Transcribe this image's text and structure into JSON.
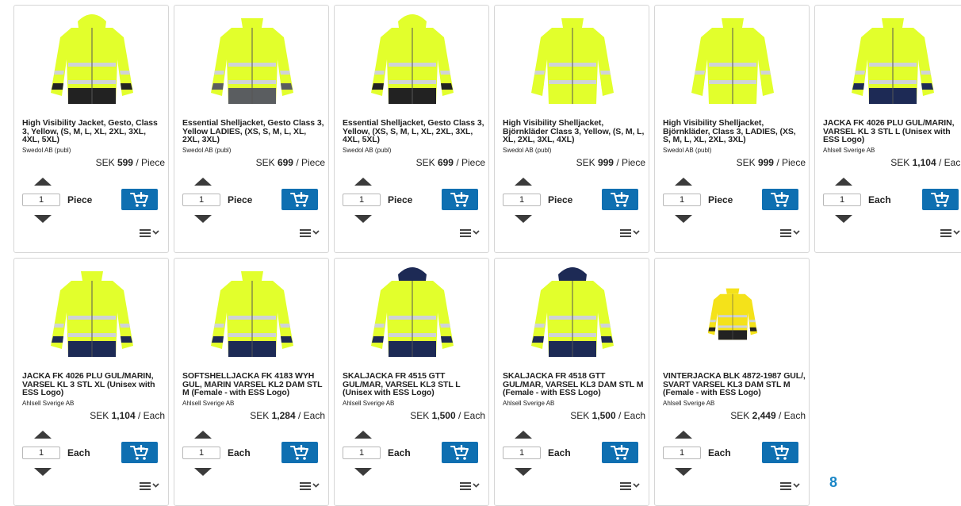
{
  "colors": {
    "accent": "#0e6fb1",
    "page_number": "#1a86c6",
    "jacket_yellow": "#e2ff2c",
    "jacket_navy": "#1d2a55"
  },
  "products": [
    {
      "title": "High Visibility Jacket, Gesto, Class 3, Yellow, (S, M, L, XL, 2XL, 3XL, 4XL, 5XL)",
      "supplier": "Swedol AB (publ)",
      "currency": "SEK",
      "amount": "599",
      "per": "/ Piece",
      "qty": "1",
      "unit": "Piece",
      "image": "hivis-yellow-black-jacket"
    },
    {
      "title": "Essential Shelljacket, Gesto Class 3, Yellow LADIES, (XS, S, M, L, XL, 2XL, 3XL)",
      "supplier": "Swedol AB (publ)",
      "currency": "SEK",
      "amount": "699",
      "per": "/ Piece",
      "qty": "1",
      "unit": "Piece",
      "image": "hivis-yellow-grey-jacket"
    },
    {
      "title": "Essential Shelljacket, Gesto Class 3, Yellow, (XS, S, M, L, XL, 2XL, 3XL, 4XL, 5XL)",
      "supplier": "Swedol AB (publ)",
      "currency": "SEK",
      "amount": "699",
      "per": "/ Piece",
      "qty": "1",
      "unit": "Piece",
      "image": "hivis-yellow-black-jacket"
    },
    {
      "title": "High Visibility Shelljacket, Björnkläder Class 3, Yellow, (S, M, L, XL, 2XL, 3XL, 4XL)",
      "supplier": "Swedol AB (publ)",
      "currency": "SEK",
      "amount": "999",
      "per": "/ Piece",
      "qty": "1",
      "unit": "Piece",
      "image": "hivis-yellow-jacket"
    },
    {
      "title": "High Visibility Shelljacket, Björnkläder, Class 3, LADIES, (XS, S, M, L, XL, 2XL, 3XL)",
      "supplier": "Swedol AB (publ)",
      "currency": "SEK",
      "amount": "999",
      "per": "/ Piece",
      "qty": "1",
      "unit": "Piece",
      "image": "hivis-yellow-jacket"
    },
    {
      "title": "JACKA FK 4026 PLU GUL/MARIN, VARSEL KL 3 STL L (Unisex with ESS Logo)",
      "supplier": "Ahlsell Sverige AB",
      "currency": "SEK",
      "amount": "1,104",
      "per": "/ Each",
      "qty": "1",
      "unit": "Each",
      "image": "hivis-yellow-navy-jacket"
    },
    {
      "title": "JACKA FK 4026 PLU GUL/MARIN, VARSEL KL 3 STL XL (Unisex with ESS Logo)",
      "supplier": "Ahlsell Sverige AB",
      "currency": "SEK",
      "amount": "1,104",
      "per": "/ Each",
      "qty": "1",
      "unit": "Each",
      "image": "hivis-yellow-navy-jacket"
    },
    {
      "title": "SOFTSHELLJACKA FK 4183 WYH GUL, MARIN VARSEL KL2 DAM STL M (Female - with ESS Logo)",
      "supplier": "Ahlsell Sverige AB",
      "currency": "SEK",
      "amount": "1,284",
      "per": "/ Each",
      "qty": "1",
      "unit": "Each",
      "image": "softshell-yellow-navy-jacket"
    },
    {
      "title": "SKALJACKA FR 4515 GTT GUL/MAR, VARSEL KL3 STL L (Unisex with ESS Logo)",
      "supplier": "Ahlsell Sverige AB",
      "currency": "SEK",
      "amount": "1,500",
      "per": "/ Each",
      "qty": "1",
      "unit": "Each",
      "image": "hooded-yellow-navy-jacket"
    },
    {
      "title": "SKALJACKA FR 4518 GTT GUL/MAR, VARSEL KL3 DAM STL M (Female - with ESS Logo)",
      "supplier": "Ahlsell Sverige AB",
      "currency": "SEK",
      "amount": "1,500",
      "per": "/ Each",
      "qty": "1",
      "unit": "Each",
      "image": "hooded-yellow-navy-jacket"
    },
    {
      "title": "VINTERJACKA BLK 4872-1987 GUL/, SVART VARSEL KL3 DAM STL M (Female - with ESS Logo)",
      "supplier": "Ahlsell Sverige AB",
      "currency": "SEK",
      "amount": "2,449",
      "per": "/ Each",
      "qty": "1",
      "unit": "Each",
      "image": "winter-yellow-black-jacket"
    }
  ],
  "pagination": {
    "current_page": "8"
  }
}
